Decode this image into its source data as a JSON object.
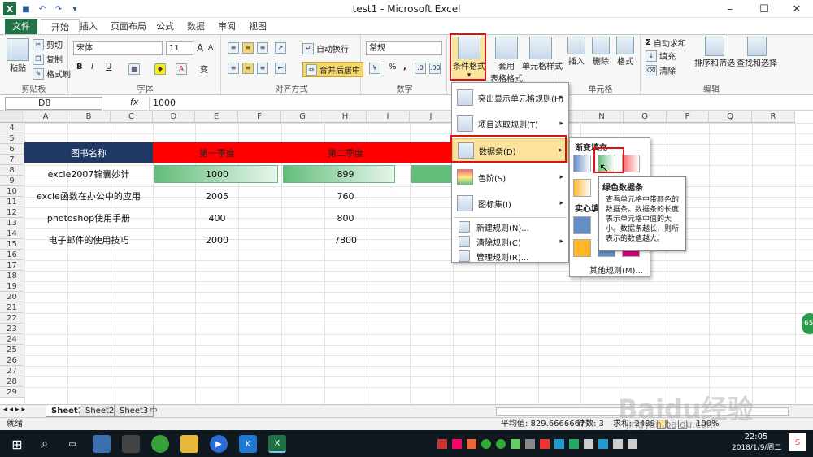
{
  "window": {
    "title": "test1 - Microsoft Excel",
    "minimize": "–",
    "maximize": "☐",
    "close": "✕"
  },
  "tabs": [
    {
      "label": "文件"
    },
    {
      "label": "开始"
    },
    {
      "label": "插入"
    },
    {
      "label": "页面布局"
    },
    {
      "label": "公式"
    },
    {
      "label": "数据"
    },
    {
      "label": "审阅"
    },
    {
      "label": "视图"
    }
  ],
  "ribbon": {
    "clipboard": {
      "label": "剪贴板",
      "paste": "粘贴",
      "cut": "剪切",
      "copy": "复制",
      "format_painter": "格式刷"
    },
    "font": {
      "label": "字体",
      "name": "宋体",
      "size": "11",
      "bold": "B",
      "italic": "I",
      "underline": "U",
      "grow": "A",
      "shrink": "A",
      "wen": "变"
    },
    "alignment": {
      "label": "对齐方式",
      "wrap": "自动换行",
      "merge": "合并后居中"
    },
    "number": {
      "label": "数字",
      "format": "常规",
      "percent": "%",
      "comma": ","
    },
    "styles": {
      "label": "样式",
      "conditional": "条件格式",
      "table": "套用",
      "table2": "表格格式",
      "cell_styles": "单元格样式"
    },
    "cells": {
      "label": "单元格",
      "insert": "插入",
      "delete": "删除",
      "format": "格式"
    },
    "editing": {
      "label": "编辑",
      "autosum": "自动求和",
      "fill": "填充",
      "clear": "清除",
      "sort": "排序和筛选",
      "find": "查找和选择"
    }
  },
  "formula_bar": {
    "name_box": "D8",
    "fx": "fx",
    "value": "1000"
  },
  "columns": [
    "A",
    "B",
    "C",
    "D",
    "E",
    "F",
    "G",
    "H",
    "I",
    "J",
    "K",
    "L",
    "M",
    "N",
    "O",
    "P",
    "Q",
    "R"
  ],
  "rows": [
    "4",
    "5",
    "6",
    "7",
    "8",
    "9",
    "10",
    "11",
    "12",
    "13",
    "14",
    "15",
    "16",
    "17",
    "18",
    "19",
    "20",
    "21",
    "22",
    "23",
    "24",
    "25",
    "26",
    "27",
    "28",
    "29"
  ],
  "table": {
    "header_name": "图书名称",
    "header_q1": "第一季度",
    "header_q2": "第二季度",
    "rows": [
      {
        "name": "excle2007锦囊妙计",
        "q1": "1000",
        "q2": "899"
      },
      {
        "name": "excle函数在办公中的应用",
        "q1": "2005",
        "q2": "760"
      },
      {
        "name": "photoshop使用手册",
        "q1": "400",
        "q2": "800"
      },
      {
        "name": "电子邮件的使用技巧",
        "q1": "2000",
        "q2": "7800"
      }
    ]
  },
  "cf_menu": {
    "items": [
      {
        "label": "突出显示单元格规则(H)"
      },
      {
        "label": "项目选取规则(T)"
      },
      {
        "label": "数据条(D)"
      },
      {
        "label": "色阶(S)"
      },
      {
        "label": "图标集(I)"
      }
    ],
    "commands": [
      {
        "label": "新建规则(N)..."
      },
      {
        "label": "清除规则(C)"
      },
      {
        "label": "管理规则(R)..."
      }
    ]
  },
  "databar_menu": {
    "gradient_header": "渐变填充",
    "solid_header": "实心填充",
    "more_rules": "其他规则(M)..."
  },
  "tooltip": {
    "title": "绿色数据条",
    "body": "查看单元格中带颜色的数据条。数据条的长度表示单元格中值的大小。数据条越长，则所表示的数值越大。"
  },
  "sheet_tabs": [
    "Sheet1",
    "Sheet2",
    "Sheet3"
  ],
  "status": {
    "ready": "就绪",
    "average": "平均值: 829.6666667",
    "count": "计数: 3",
    "sum": "求和: 2489",
    "zoom": "100%"
  },
  "taskbar": {
    "time": "22:05",
    "date": "2018/1/9/周二"
  },
  "watermark": {
    "text": "Baidu经验",
    "url": "jingyan.baidu.com"
  },
  "colors": {
    "header_navy": "#1f3864",
    "header_red": "#ff0000",
    "databar_green": "#63be7b",
    "excel_green": "#217346",
    "highlight_red": "#dd1111"
  }
}
